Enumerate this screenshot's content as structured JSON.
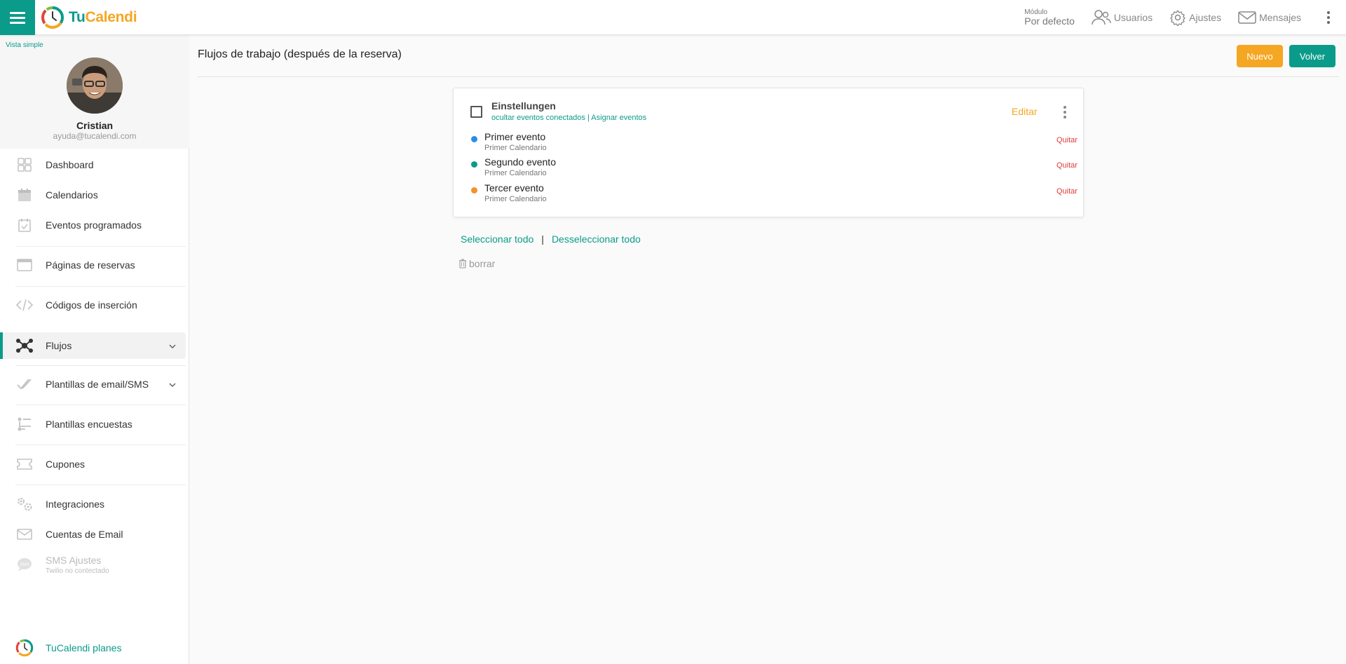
{
  "app": {
    "logo_tu": "Tu",
    "logo_cal": "Calend",
    "logo_i": "i"
  },
  "topbar": {
    "modulo_label": "Módulo",
    "modulo_value": "Por defecto",
    "usuarios": "Usuarios",
    "ajustes": "Ajustes",
    "mensajes": "Mensajes"
  },
  "sidebar": {
    "vista_simple": "Vista simple",
    "user_name": "Cristian",
    "user_email": "ayuda@tucalendi.com",
    "items": [
      {
        "label": "Dashboard",
        "icon": "dashboard-icon"
      },
      {
        "label": "Calendarios",
        "icon": "calendar-icon"
      },
      {
        "label": "Eventos programados",
        "icon": "calendar-check-icon"
      },
      {
        "label": "Páginas de reservas",
        "icon": "browser-window-icon"
      },
      {
        "label": "Códigos de inserción",
        "icon": "code-icon"
      },
      {
        "label": "Flujos",
        "icon": "workflow-icon"
      },
      {
        "label": "Plantillas de email/SMS",
        "icon": "double-check-icon"
      },
      {
        "label": "Plantillas encuestas",
        "icon": "survey-icon"
      },
      {
        "label": "Cupones",
        "icon": "ticket-icon"
      },
      {
        "label": "Integraciones",
        "icon": "gears-icon"
      },
      {
        "label": "Cuentas de Email",
        "icon": "envelope-icon"
      },
      {
        "label": "SMS Ajustes",
        "icon": "sms-bubble-icon",
        "sub": "Twilio no contectado"
      }
    ],
    "planes": "TuCalendi planes"
  },
  "main": {
    "title": "Flujos de trabajo (después de la reserva)",
    "btn_nuevo": "Nuevo",
    "btn_volver": "Volver",
    "workflow": {
      "name": "Einstellungen",
      "link_hide": "ocultar eventos conectados",
      "link_sep": " | ",
      "link_assign": "Asignar eventos",
      "edit": "Editar",
      "events": [
        {
          "name": "Primer evento",
          "calendar": "Primer Calendario",
          "color": "#2b8de3",
          "action": "Quitar"
        },
        {
          "name": "Segundo evento",
          "calendar": "Primer Calendario",
          "color": "#0b9b8a",
          "action": "Quitar"
        },
        {
          "name": "Tercer evento",
          "calendar": "Primer Calendario",
          "color": "#f5922a",
          "action": "Quitar"
        }
      ]
    },
    "select_all": "Seleccionar todo",
    "pipe": "|",
    "deselect_all": "Desseleccionar todo",
    "delete": "borrar"
  },
  "colors": {
    "accent": "#0b9b8a",
    "orange": "#f5a623",
    "danger": "#e03a3a"
  }
}
